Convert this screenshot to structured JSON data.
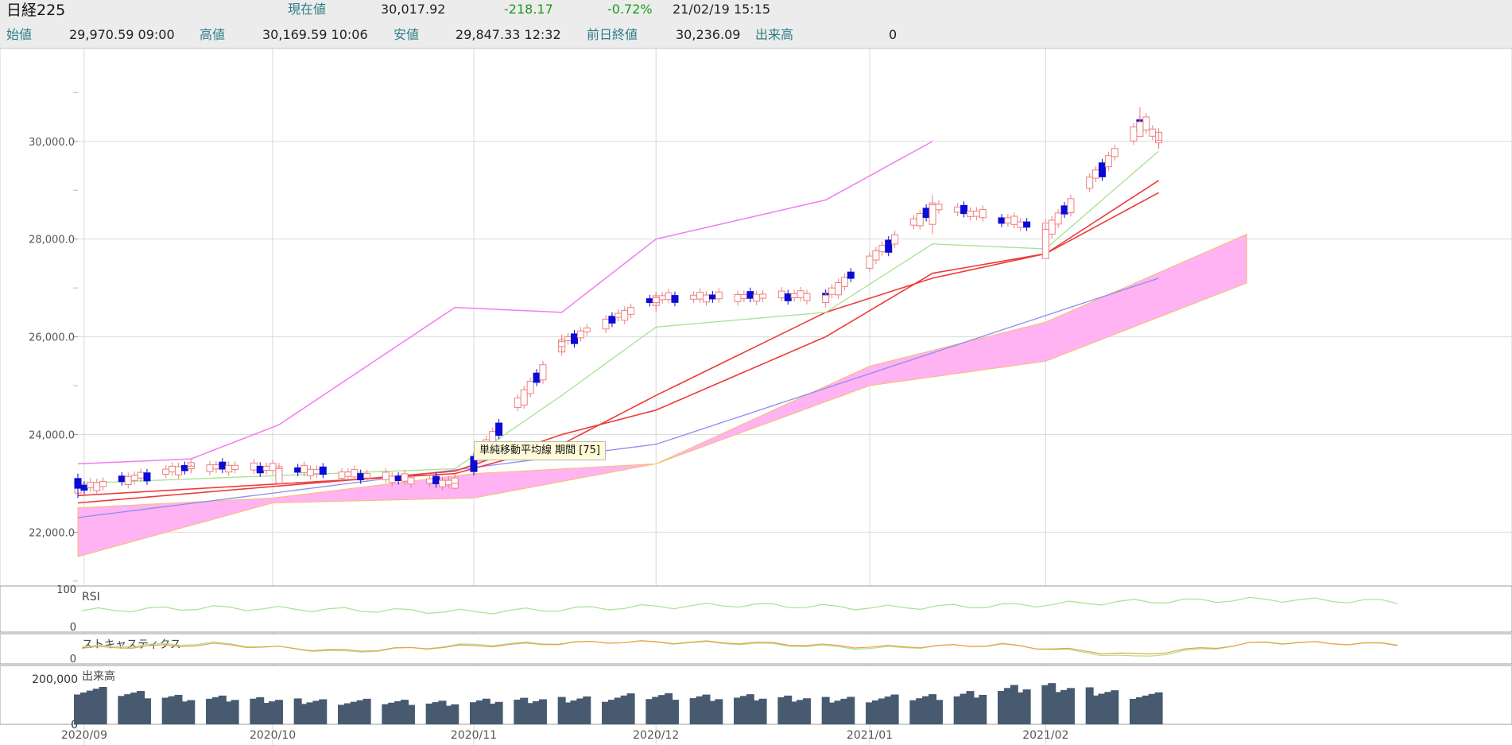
{
  "header": {
    "title": "日経225",
    "current_label": "現在値",
    "current_value": "30,017.92",
    "change_value": "-218.17",
    "change_pct": "-0.72%",
    "datetime": "21/02/19  15:15",
    "open_label": "始値",
    "open_value": "29,970.59  09:00",
    "high_label": "高値",
    "high_value": "30,169.59  10:06",
    "low_label": "安値",
    "low_value": "29,847.33  12:32",
    "prev_close_label": "前日終値",
    "prev_close_value": "30,236.09",
    "volume_label": "出来高",
    "volume_value": "0"
  },
  "tooltip": "単純移動平均線 期間 [75]",
  "colors": {
    "up_candle": "#f07e7e",
    "down_candle": "#0b0bd6",
    "cloud": "#ffb3f2",
    "cloud_edge": "#f3c06a",
    "chikou": "#f07cf0",
    "ma_short": "#a6e290",
    "ma_red": "#ee3a3a",
    "ma75": "#8c8cf0",
    "volume_bar": "#475a70",
    "rsi_line": "#a6e290",
    "stoch_k": "#a6e290",
    "stoch_d": "#f1a040"
  },
  "chart_data": {
    "type": "candlestick",
    "y_ticks": [
      "30,000.0",
      "28,000.0",
      "26,000.0",
      "24,000.0",
      "22,000.0"
    ],
    "y_tick_values": [
      30000,
      28000,
      26000,
      24000,
      22000
    ],
    "ylim": [
      20900,
      31900
    ],
    "x_tick_labels": [
      "2020/09",
      "2020/10",
      "2020/11",
      "2020/12",
      "2021/01",
      "2021/02"
    ],
    "x_tick_dates": [
      "2020-09-01",
      "2020-10-01",
      "2020-11-02",
      "2020-12-01",
      "2021-01-04",
      "2021-02-01"
    ],
    "ohlc_dates": [
      "2020-08-31",
      "2020-09-18",
      "2020-10-02",
      "2020-10-30",
      "2020-11-16",
      "2020-12-01",
      "2020-12-28",
      "2021-01-14",
      "2021-02-01",
      "2021-02-16",
      "2021-02-19"
    ],
    "ohlc": [
      [
        23100,
        23200,
        22700,
        22900
      ],
      [
        23300,
        23400,
        23200,
        23350
      ],
      [
        23000,
        23400,
        23000,
        23300
      ],
      [
        22900,
        23000,
        22900,
        23000
      ],
      [
        25800,
        26050,
        25700,
        25900
      ],
      [
        26700,
        26900,
        26500,
        26800
      ],
      [
        26700,
        26900,
        26600,
        26850
      ],
      [
        28300,
        28900,
        28100,
        28700
      ],
      [
        27600,
        28300,
        27600,
        28200
      ],
      [
        30100,
        30700,
        30100,
        30400
      ],
      [
        29970,
        30170,
        29850,
        30018
      ]
    ],
    "ma_short_dates": [
      "2020-08-31",
      "2020-10-30",
      "2020-11-16",
      "2020-12-01",
      "2020-12-28",
      "2021-01-14",
      "2021-02-01",
      "2021-02-19"
    ],
    "ma_short": [
      23000,
      23300,
      24800,
      26200,
      26500,
      27900,
      27800,
      29800
    ],
    "ma_red_a": [
      22600,
      23250,
      24000,
      24500,
      26000,
      27300,
      27700,
      29200
    ],
    "ma_red_b": [
      22750,
      23200,
      23800,
      24800,
      26500,
      27200,
      27700,
      28950
    ],
    "ma75_dates": [
      "2020-08-31",
      "2020-10-01",
      "2020-12-01",
      "2021-02-19"
    ],
    "ma75": [
      22300,
      22800,
      23800,
      27200
    ],
    "chikou_dates": [
      "2020-08-31",
      "2020-09-18",
      "2020-10-02",
      "2020-10-30",
      "2020-11-16",
      "2020-12-01",
      "2020-12-28",
      "2021-01-14"
    ],
    "chikou": [
      23400,
      23500,
      24200,
      26600,
      26500,
      28000,
      28800,
      30000
    ],
    "cloud_dates": [
      "2020-08-31",
      "2020-10-01",
      "2020-11-02",
      "2020-12-01",
      "2021-01-04",
      "2021-02-01",
      "2021-03-05"
    ],
    "cloud_a": [
      22500,
      22700,
      23200,
      23400,
      25400,
      26300,
      28100
    ],
    "cloud_b": [
      21500,
      22600,
      22700,
      23400,
      25000,
      25500,
      27100
    ],
    "rsi_label": "RSI",
    "rsi_ticks": [
      "100",
      "0"
    ],
    "rsi": [
      48,
      55,
      50,
      45,
      55,
      62,
      55,
      60,
      70,
      75,
      70
    ],
    "stoch_label": "ストキャスティクス",
    "stoch_ticks": [
      "0"
    ],
    "stoch_k": [
      60,
      75,
      40,
      70,
      80,
      75,
      55,
      70,
      20,
      80,
      70
    ],
    "stoch_d": [
      55,
      70,
      45,
      65,
      80,
      78,
      60,
      68,
      30,
      78,
      72
    ],
    "volume_label": "出来高",
    "volume_ticks": [
      "200,000",
      "0"
    ],
    "volume_tick_values": [
      200000,
      0
    ],
    "volume": [
      155000,
      115000,
      105000,
      95000,
      110000,
      125000,
      110000,
      120000,
      165000,
      130000,
      125000
    ]
  }
}
